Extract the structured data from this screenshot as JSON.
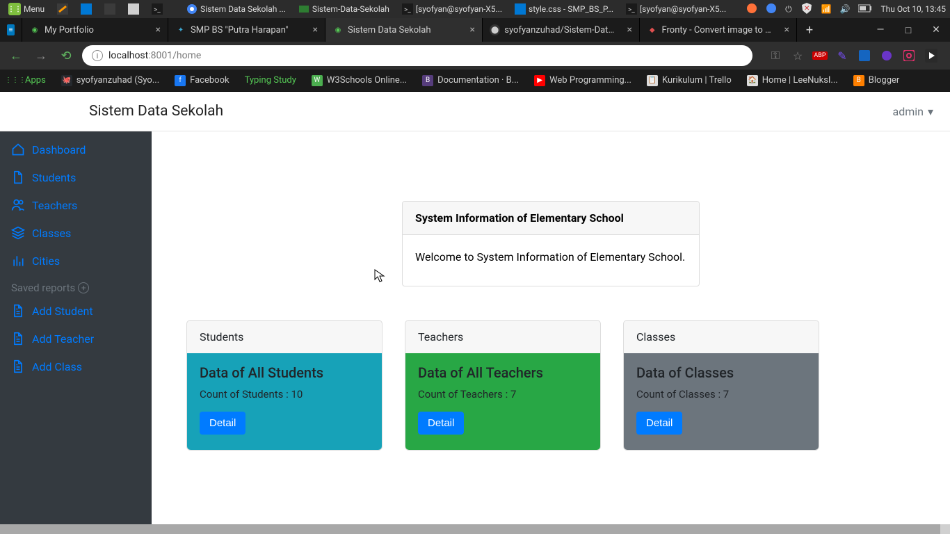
{
  "os": {
    "menu": "Menu",
    "tasks": [
      "Sistem Data Sekolah ...",
      "Sistem-Data-Sekolah",
      "[syofyan@syofyan-X5...",
      "style.css - SMP_BS_P...",
      "[syofyan@syofyan-X5..."
    ],
    "clock": "Thu Oct 10, 13:45"
  },
  "browser": {
    "tabs": [
      {
        "label": "My Portfolio",
        "fav": "#55c955",
        "active": false
      },
      {
        "label": "SMP BS \"Putra Harapan\"",
        "fav": "#3da9d4",
        "active": false
      },
      {
        "label": "Sistem Data Sekolah",
        "fav": "#55c955",
        "active": true
      },
      {
        "label": "syofyanzuhad/Sistem-Data-S",
        "fav": "#6e6e6e",
        "active": false
      },
      {
        "label": "Fronty - Convert image to HT",
        "fav": "#e05050",
        "active": false
      }
    ],
    "url_host": "localhost",
    "url_path": ":8001/home"
  },
  "bookmarks": [
    "Apps",
    "syofyanzuhad (Syo...",
    "Facebook",
    "Typing Study",
    "W3Schools Online...",
    "Documentation · B...",
    "Web Programming...",
    "Kurikulum | Trello",
    "Home | LeeNuksI...",
    "Blogger"
  ],
  "app": {
    "brand": "Sistem Data Sekolah",
    "user": "admin",
    "nav": [
      "Dashboard",
      "Students",
      "Teachers",
      "Classes",
      "Cities"
    ],
    "saved": "Saved reports",
    "quick": [
      "Add Student",
      "Add Teacher",
      "Add Class"
    ],
    "welcome": {
      "title": "System Information of Elementary School",
      "body": "Welcome to System Information of Elementary School."
    },
    "cards": [
      {
        "head": "Students",
        "title": "Data of All Students",
        "count": "Count of Students : 10",
        "btn": "Detail"
      },
      {
        "head": "Teachers",
        "title": "Data of All Teachers",
        "count": "Count of Teachers : 7",
        "btn": "Detail"
      },
      {
        "head": "Classes",
        "title": "Data of Classes",
        "count": "Count of Classes : 7",
        "btn": "Detail"
      }
    ]
  }
}
